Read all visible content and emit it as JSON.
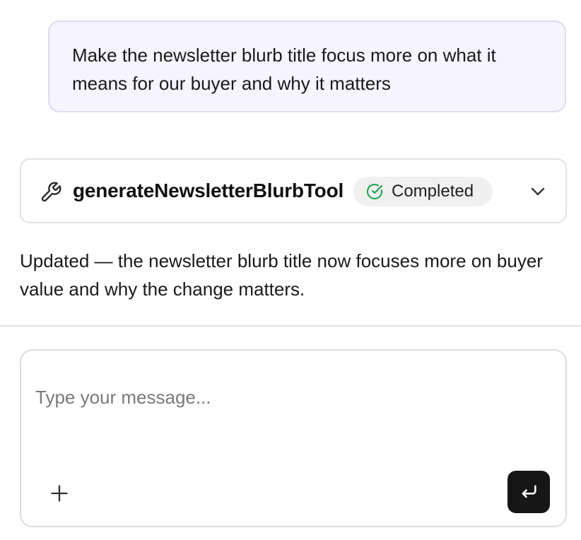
{
  "user_message": {
    "text": "Make the newsletter blurb title focus more on what it means for our buyer and why it matters"
  },
  "tool_call": {
    "icon": "wrench-icon",
    "name": "generateNewsletterBlurbTool",
    "status_icon": "check-circle-icon",
    "status": "Completed",
    "status_color": "#16a34a",
    "expand_icon": "chevron-down-icon"
  },
  "assistant_message": {
    "text": "Updated — the newsletter blurb title now focuses more on buyer value and why the change matters."
  },
  "composer": {
    "placeholder": "Type your message...",
    "value": "",
    "add_icon": "plus-icon",
    "send_icon": "enter-return-icon",
    "send_button_color": "#161616"
  }
}
